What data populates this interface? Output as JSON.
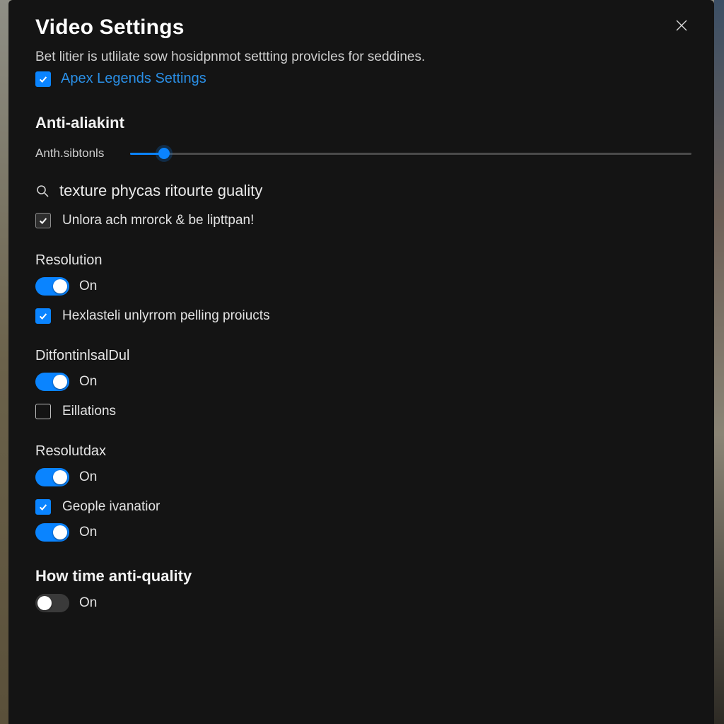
{
  "header": {
    "title": "Video Settings",
    "subtitle": "Bet litier is utlilate sow hosidpnmot settting provicles for seddines.",
    "link_label": "Apex Legends Settings",
    "link_checked": true
  },
  "anti_aliasing": {
    "title": "Anti-aliakint",
    "slider_label": "Anth.sibtonls",
    "slider_percent": 6
  },
  "texture": {
    "title": "texture phycas ritourte guality",
    "option_label": "Unlora ach mrorck & be lipttpan!",
    "option_checked": true
  },
  "groups": [
    {
      "label": "Resolution",
      "toggle_on": true,
      "toggle_text": "On",
      "has_check": true,
      "check_checked": true,
      "check_label": "Hexlasteli unlyrrom pelling proiucts",
      "extra_toggle": false
    },
    {
      "label": "DitfontinlsalDul",
      "toggle_on": true,
      "toggle_text": "On",
      "has_check": true,
      "check_checked": false,
      "check_label": "Eillations",
      "extra_toggle": false
    },
    {
      "label": "Resolutdax",
      "toggle_on": true,
      "toggle_text": "On",
      "has_check": true,
      "check_checked": true,
      "check_label": "Geople ivanatior",
      "extra_toggle": true,
      "extra_toggle_on": true,
      "extra_toggle_text": "On"
    }
  ],
  "footer": {
    "title": "How time anti-quality",
    "toggle_on": false,
    "toggle_text": "On"
  },
  "colors": {
    "accent": "#0a84ff"
  }
}
